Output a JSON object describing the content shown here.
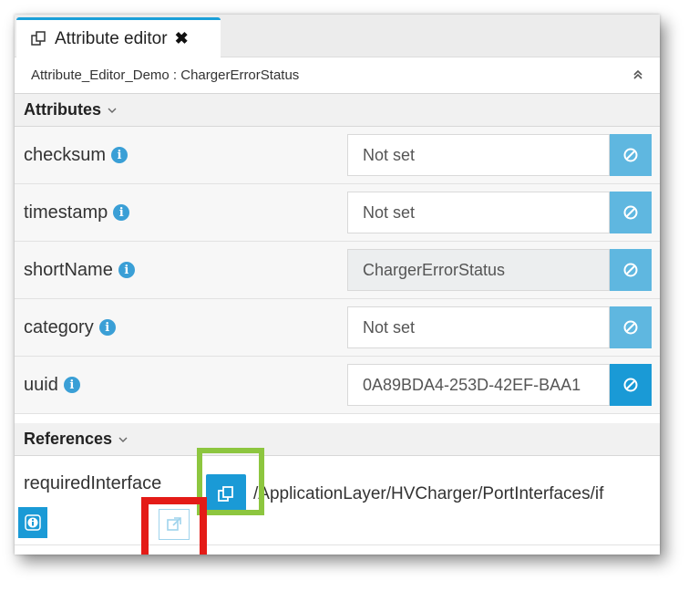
{
  "tab": {
    "title": "Attribute editor",
    "close": "✖"
  },
  "path": {
    "text": "Attribute_Editor_Demo : ChargerErrorStatus"
  },
  "attributes_section": {
    "label": "Attributes"
  },
  "attributes": [
    {
      "name": "checksum",
      "value": "Not set"
    },
    {
      "name": "timestamp",
      "value": "Not set"
    },
    {
      "name": "shortName",
      "value": "ChargerErrorStatus"
    },
    {
      "name": "category",
      "value": "Not set"
    },
    {
      "name": "uuid",
      "value": "0A89BDA4-253D-42EF-BAA1"
    }
  ],
  "references_section": {
    "label": "References"
  },
  "references": [
    {
      "name": "requiredInterface",
      "value": "/ApplicationLayer/HVCharger/PortInterfaces/if"
    }
  ],
  "colors": {
    "accent": "#1a9ad6",
    "light_accent": "#5fb7e0",
    "highlight_green": "#8dc63f",
    "highlight_red": "#e41b17"
  }
}
